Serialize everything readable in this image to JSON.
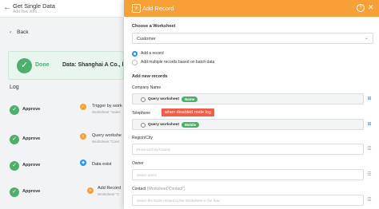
{
  "background": {
    "title": "Get Single Data",
    "subtitle": "Add flow intro...",
    "back_label": "Back",
    "done_label": "Done",
    "done_data": "Data: Shanghai A Co., l",
    "log_title": "Log",
    "log_rows": [
      {
        "status": "Approve",
        "node": "Trigger by work",
        "sub": "Worksheet \"Sales",
        "icon_color": "#f7a038",
        "icon": "⚡"
      },
      {
        "status": "Approve",
        "node": "Query workshe",
        "sub": "Worksheet \"Cont",
        "icon_color": "#f7a038",
        "icon": "≡"
      },
      {
        "status": "Approve",
        "node": "Data exist",
        "sub": "",
        "icon_color": "#2196f3",
        "icon": "◆"
      },
      {
        "status": "Approve",
        "node": "Add Record",
        "sub": "Worksheet \"C",
        "icon_color": "#f7a038",
        "icon": "+"
      }
    ]
  },
  "drawer": {
    "title": "Add Record",
    "help_icon": "?",
    "close_icon": "✕",
    "choose_label": "Choose a Worksheet",
    "worksheet_value": "Customer",
    "radio_options": [
      {
        "label": "Add a record",
        "selected": true
      },
      {
        "label": "Add multiple records based on batch data",
        "selected": false
      }
    ],
    "new_records_label": "Add new records",
    "warning": "when disabled node log",
    "fields": [
      {
        "label": "Company Name",
        "tag_text": "Query worksheet",
        "tag_pill": "Name",
        "placeholder": ""
      },
      {
        "label": "Telephone",
        "tag_text": "Query worksheet",
        "tag_pill": "Mobile",
        "placeholder": ""
      },
      {
        "label": "Region/City",
        "tag_text": "",
        "tag_pill": "",
        "placeholder": "Province/City/County"
      },
      {
        "label": "Owner",
        "tag_text": "",
        "tag_pill": "",
        "placeholder": "Select users"
      },
      {
        "label": "Contact",
        "label_suffix": "(Worksheet\"Contact\")",
        "tag_text": "",
        "tag_pill": "",
        "placeholder": "Select the Node related to the Worksheet in the flow"
      }
    ]
  },
  "colors": {
    "accent": "#f7a038",
    "success": "#4caf6b",
    "primary": "#2196f3",
    "warning": "#f25e4a"
  }
}
